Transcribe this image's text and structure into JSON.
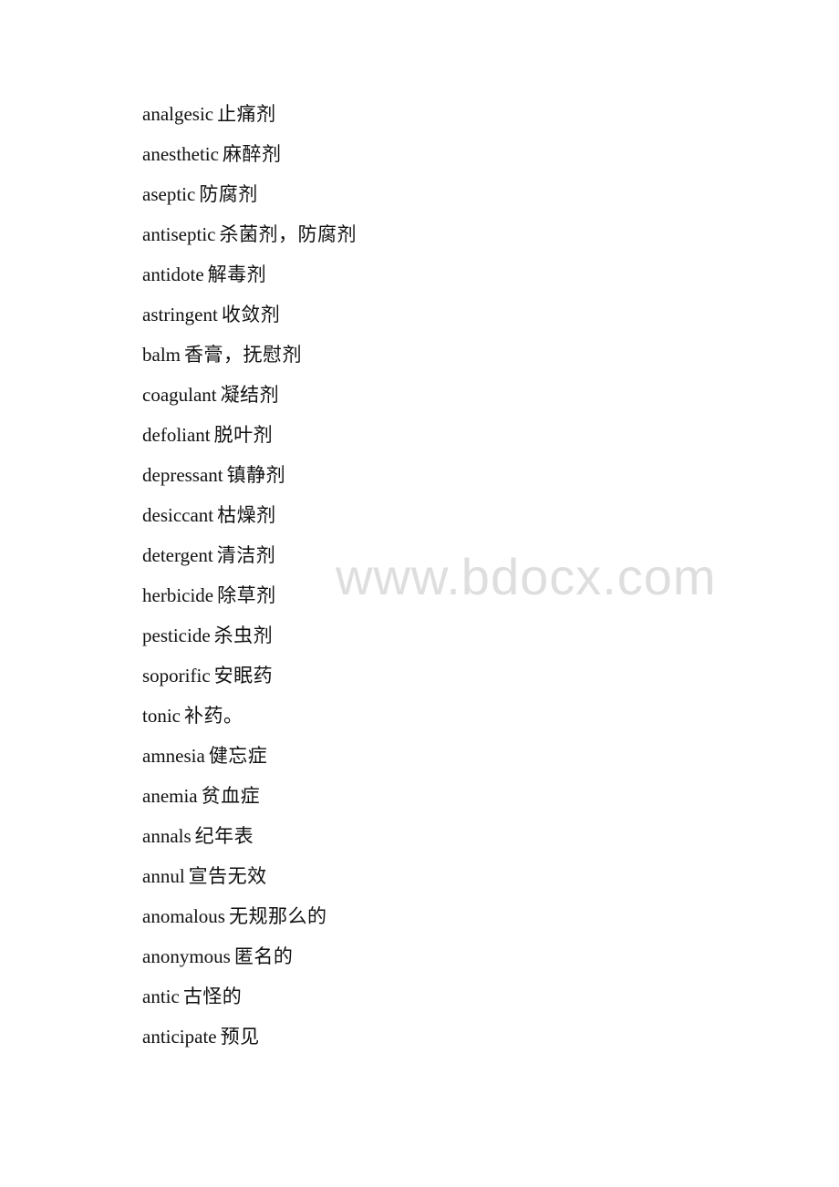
{
  "document": {
    "entries": [
      {
        "term": "analgesic",
        "definition": "止痛剂"
      },
      {
        "term": "anesthetic",
        "definition": "麻醉剂"
      },
      {
        "term": "aseptic",
        "definition": "防腐剂"
      },
      {
        "term": "antiseptic",
        "definition": "杀菌剂，防腐剂"
      },
      {
        "term": "antidote",
        "definition": "解毒剂"
      },
      {
        "term": "astringent",
        "definition": "收敛剂"
      },
      {
        "term": "balm",
        "definition": "香膏，抚慰剂"
      },
      {
        "term": "coagulant",
        "definition": "凝结剂"
      },
      {
        "term": "defoliant",
        "definition": "脱叶剂"
      },
      {
        "term": "depressant",
        "definition": "镇静剂"
      },
      {
        "term": "desiccant",
        "definition": "枯燥剂"
      },
      {
        "term": "detergent",
        "definition": "清洁剂"
      },
      {
        "term": "herbicide",
        "definition": "除草剂"
      },
      {
        "term": "pesticide",
        "definition": "杀虫剂"
      },
      {
        "term": "soporific",
        "definition": "安眠药"
      },
      {
        "term": "tonic",
        "definition": "补药。"
      },
      {
        "term": "amnesia",
        "definition": "健忘症"
      },
      {
        "term": "anemia",
        "definition": "贫血症"
      },
      {
        "term": "annals",
        "definition": "纪年表"
      },
      {
        "term": "annul",
        "definition": "宣告无效"
      },
      {
        "term": "anomalous",
        "definition": "无规那么的"
      },
      {
        "term": "anonymous",
        "definition": "匿名的"
      },
      {
        "term": "antic",
        "definition": "古怪的"
      },
      {
        "term": "anticipate",
        "definition": "预见"
      }
    ]
  },
  "watermark": {
    "text": "www.bdocx.com",
    "color": "#d9d9d9"
  }
}
